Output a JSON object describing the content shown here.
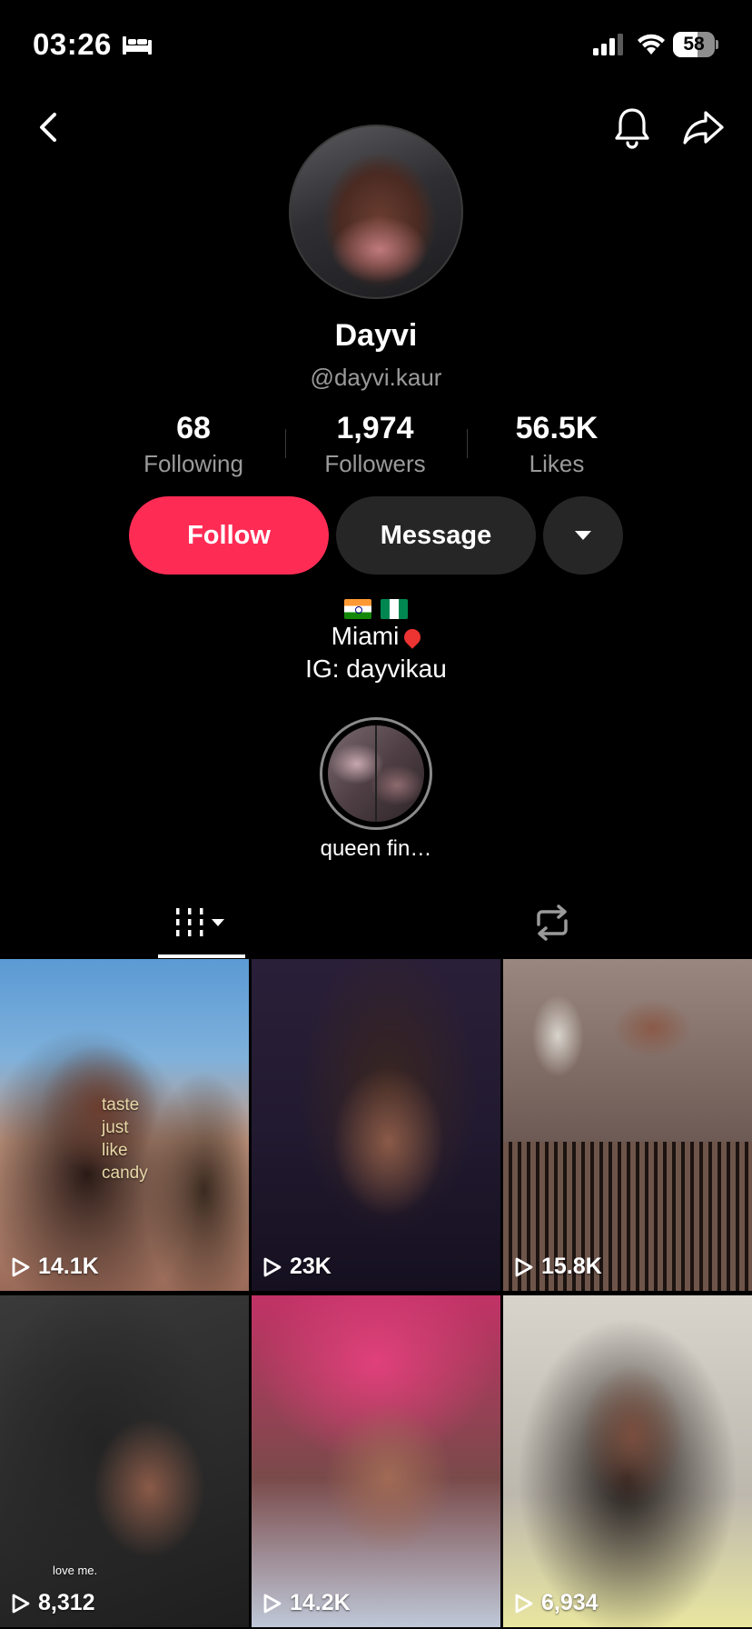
{
  "status_bar": {
    "time": "03:26",
    "battery_level": "58",
    "battery_fraction": 0.58,
    "icons": [
      "bed-icon",
      "signal-icon",
      "wifi-icon",
      "battery-icon"
    ]
  },
  "nav": {
    "back_icon": "chevron-left-icon",
    "bell_icon": "bell-icon",
    "share_icon": "share-arrow-icon"
  },
  "profile": {
    "display_name": "Dayvi",
    "username": "@dayvi.kaur"
  },
  "stats": [
    {
      "value": "68",
      "label": "Following"
    },
    {
      "value": "1,974",
      "label": "Followers"
    },
    {
      "value": "56.5K",
      "label": "Likes"
    }
  ],
  "actions": {
    "follow_label": "Follow",
    "message_label": "Message",
    "more_icon": "caret-down-icon"
  },
  "colors": {
    "follow_button": "#fe2c55",
    "secondary_button": "#262626",
    "background": "#000000"
  },
  "bio": {
    "flags": [
      "india-flag",
      "nigeria-flag"
    ],
    "location": "Miami",
    "ig": "IG: dayvikau"
  },
  "highlight": {
    "label": "queen fin…"
  },
  "tabs": [
    {
      "name": "videos",
      "icon": "grid-bars-icon",
      "active": true
    },
    {
      "name": "reposts",
      "icon": "repost-icon",
      "active": false
    }
  ],
  "videos": [
    {
      "views": "14.1K",
      "overlay": [
        "taste",
        "just",
        "like",
        "candy"
      ]
    },
    {
      "views": "23K"
    },
    {
      "views": "15.8K"
    },
    {
      "views": "8,312",
      "overlay": [
        "love me."
      ]
    },
    {
      "views": "14.2K"
    },
    {
      "views": "6,934"
    }
  ]
}
